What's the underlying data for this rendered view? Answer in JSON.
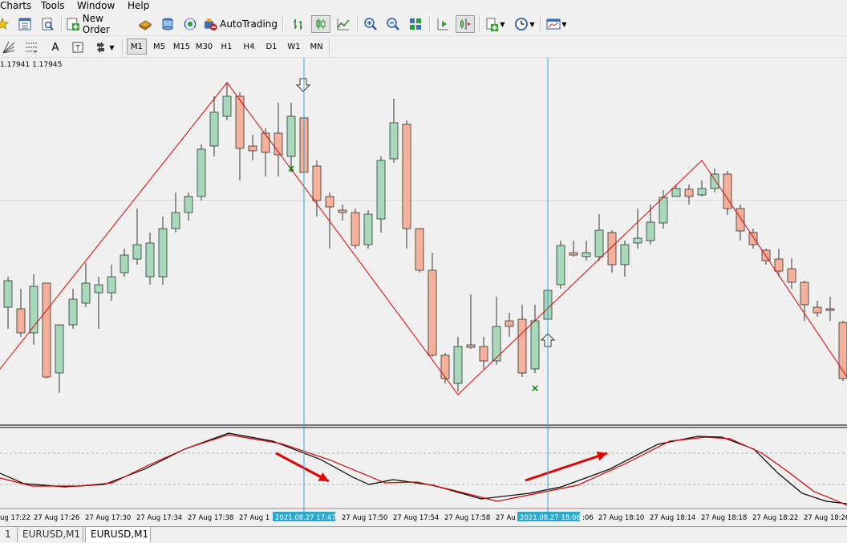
{
  "menu": {
    "items": [
      "Charts",
      "Tools",
      "Window",
      "Help"
    ]
  },
  "toolbar": {
    "new_order_label": "New Order",
    "autotrading_label": "AutoTrading",
    "timeframes": [
      "M1",
      "M5",
      "M15",
      "M30",
      "H1",
      "H4",
      "D1",
      "W1",
      "MN"
    ],
    "active_timeframe": "M1"
  },
  "chart": {
    "ohlc_text": "1.17941 1.17945",
    "crosshair_labels": [
      "2021.08.27 17:47",
      "2021.08.27 18:06"
    ],
    "time_labels": [
      "ug 17:22",
      "27 Aug 17:26",
      "27 Aug 17:30",
      "27 Aug 17:34",
      "27 Aug 17:38",
      "27 Aug 1",
      "27 Aug 17:50",
      "27 Aug 17:54",
      "27 Aug 17:58",
      "27 Au",
      ":06",
      "27 Aug 18:10",
      "27 Aug 18:14",
      "27 Aug 18:18",
      "27 Aug 18:22",
      "27 Aug 18:26"
    ],
    "colors": {
      "bull": "#a5d9b9",
      "bear": "#f4b09a",
      "zigzag": "#e00000",
      "crosshair": "#2aa8d0",
      "label_bg": "#2aa8d0",
      "arrow": "#e00000",
      "signal_x": "#008000"
    }
  },
  "tabs": {
    "items": [
      "1",
      "EURUSD,M1",
      "EURUSD,M1"
    ],
    "active_index": 2
  }
}
